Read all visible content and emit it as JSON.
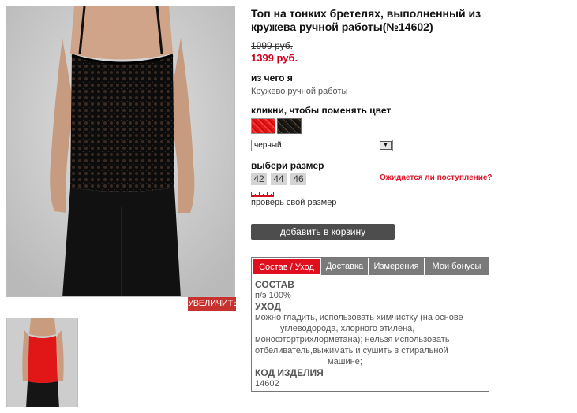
{
  "product": {
    "title": "Топ на тонких бретелях, выполненный из кружева ручной работы(№14602)",
    "old_price": "1999 руб.",
    "new_price": "1399 руб."
  },
  "gallery": {
    "zoom_label": "УВЕЛИЧИТЬ"
  },
  "material": {
    "label": "из чего я",
    "value": "Кружево ручной работы"
  },
  "color": {
    "label": "кликни, чтобы поменять цвет",
    "selected": "черный",
    "swatches": [
      "red",
      "black"
    ]
  },
  "size": {
    "label": "выбери размер",
    "options": [
      "42",
      "44",
      "46"
    ],
    "waiting_link": "Ожидается ли поступление?",
    "check_link": "проверь свой размер"
  },
  "cart": {
    "button_label": "добавить в корзину"
  },
  "tabs": {
    "items": [
      "Состав / Уход",
      "Доставка",
      "Измерения",
      "Мои бонусы"
    ],
    "active": "Состав / Уход",
    "content": {
      "composition_heading": "СОСТАВ",
      "composition_value": "п/э 100%",
      "care_heading": "УХОД",
      "care_lines": [
        "можно гладить, использовать химчистку (на основе",
        "углеводорода, хлорного этилена,",
        "монофтортрихлорметана); нельзя использовать",
        "отбеливатель,выжимать и сушить в стиральной",
        "машине;"
      ],
      "code_heading": "КОД ИЗДЕЛИЯ",
      "code_value": "14602"
    }
  },
  "colors": {
    "accent_red": "#e00f1e",
    "price_red": "#d6001c",
    "dark_button": "#4d4d4d",
    "tab_grey": "#7a7a7a"
  }
}
